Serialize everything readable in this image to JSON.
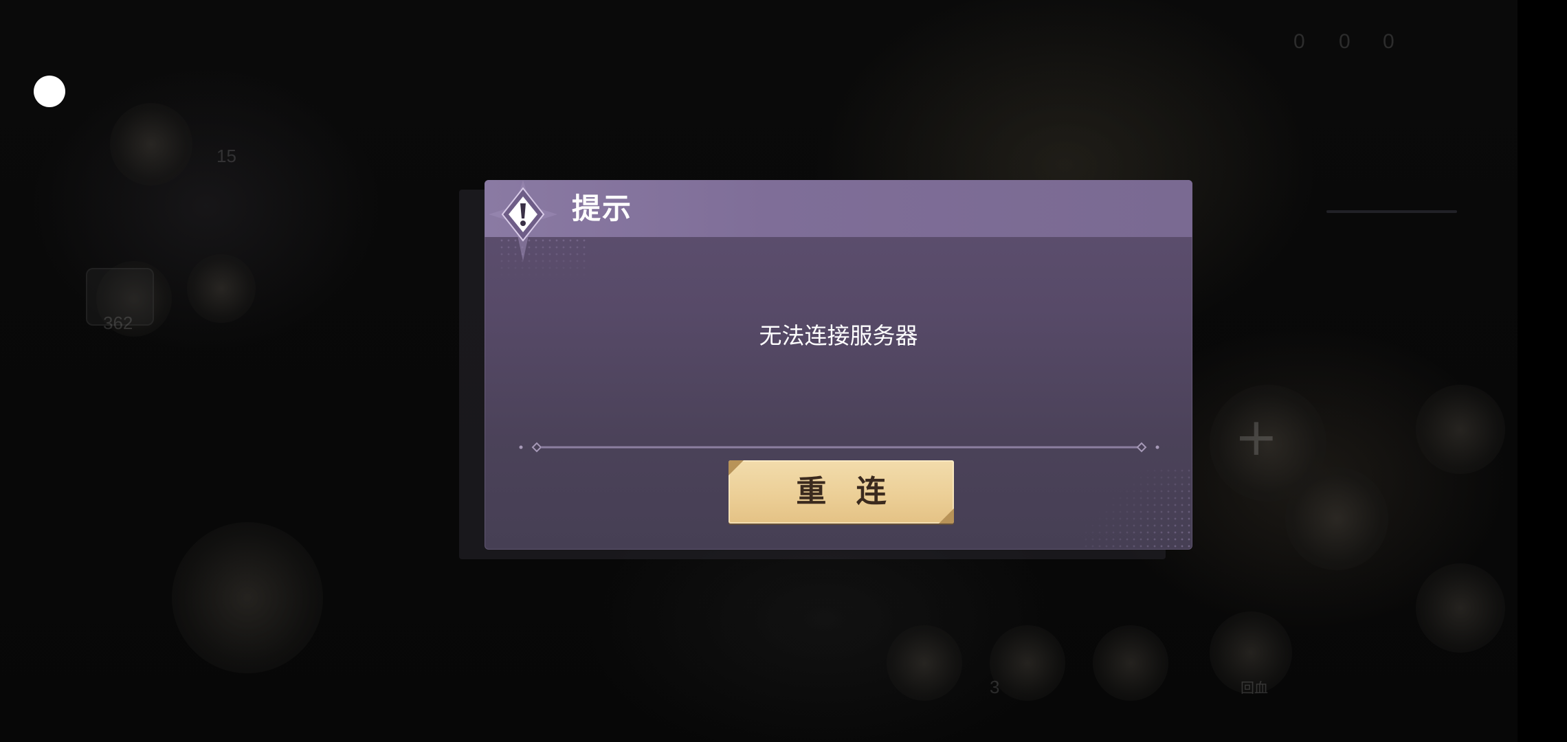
{
  "background_hud": {
    "counters": [
      "0",
      "0",
      "0"
    ],
    "left_number_1": "15",
    "left_number_2": "362",
    "bottom_labels": [
      "",
      "",
      "",
      "回血"
    ],
    "badge_number": "3"
  },
  "dialog": {
    "title": "提示",
    "message": "无法连接服务器",
    "button_label": "重 连"
  },
  "colors": {
    "dialog_header": "#7f6e98",
    "dialog_body": "#574a68",
    "button_gold": "#eccf97",
    "button_text": "#3b2a1e"
  },
  "icons": {
    "dialog_badge": "exclamation-diamond-icon",
    "floating_button": "assistive-touch-icon",
    "background_plus": "plus-icon"
  }
}
